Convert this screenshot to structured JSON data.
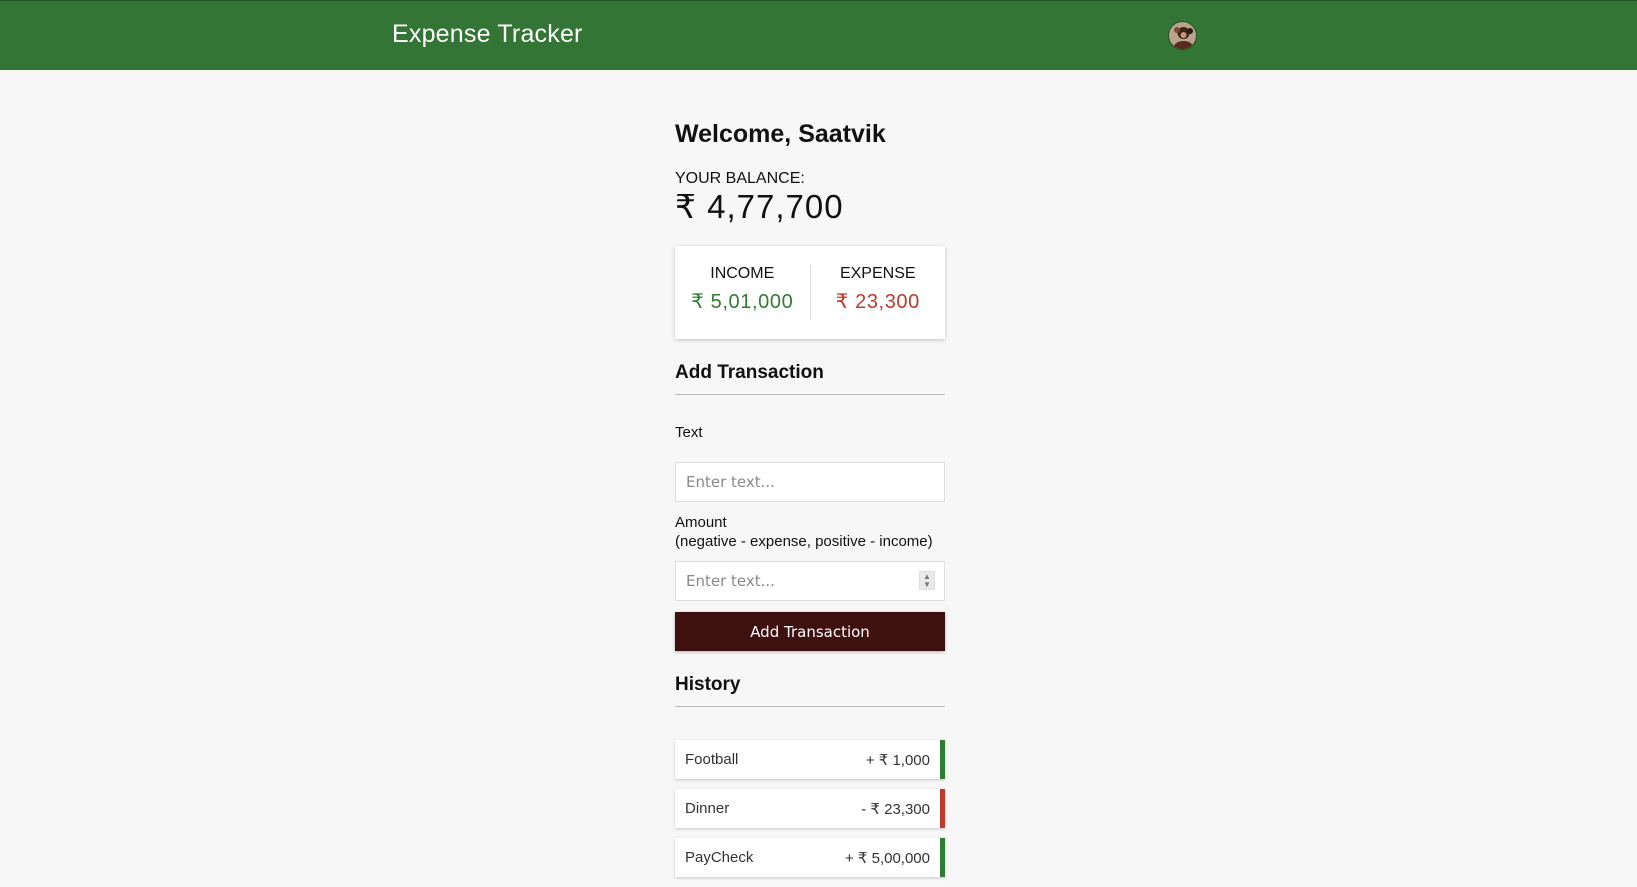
{
  "header": {
    "title": "Expense Tracker",
    "avatar_icon": "user-avatar"
  },
  "welcome": "Welcome, Saatvik",
  "balance": {
    "label": "YOUR BALANCE:",
    "value": "₹ 4,77,700"
  },
  "summary": {
    "income_label": "INCOME",
    "income_value": "₹ 5,01,000",
    "expense_label": "EXPENSE",
    "expense_value": "₹ 23,300",
    "income_color": "#2e7d32",
    "expense_color": "#c0392b"
  },
  "add_transaction": {
    "title": "Add Transaction",
    "text_label": "Text",
    "text_placeholder": "Enter text...",
    "amount_label": "Amount",
    "amount_hint": "(negative - expense, positive - income)",
    "amount_placeholder": "Enter text...",
    "button_label": "Add Transaction"
  },
  "history": {
    "title": "History",
    "items": [
      {
        "text": "Football",
        "amount": "+ ₹ 1,000",
        "type": "income"
      },
      {
        "text": "Dinner",
        "amount": "- ₹ 23,300",
        "type": "expense"
      },
      {
        "text": "PayCheck",
        "amount": "+ ₹ 5,00,000",
        "type": "income"
      }
    ]
  }
}
